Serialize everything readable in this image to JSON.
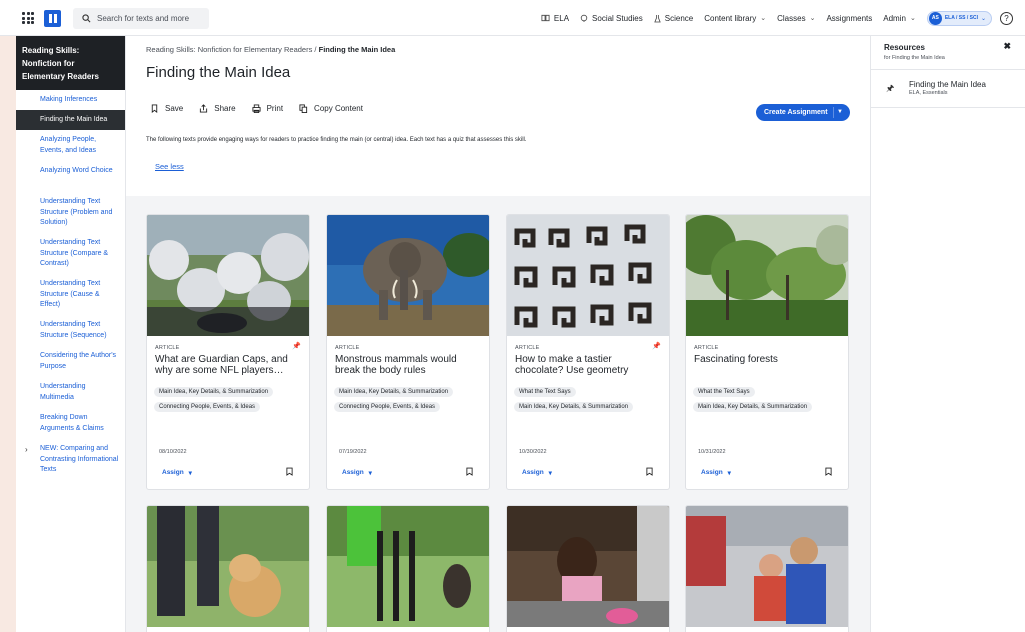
{
  "topbar": {
    "search_placeholder": "Search for texts and more",
    "nav": [
      {
        "label": "ELA",
        "icon": "book-icon"
      },
      {
        "label": "Social Studies",
        "icon": "globe-icon"
      },
      {
        "label": "Science",
        "icon": "flask-icon"
      },
      {
        "label": "Content library",
        "icon": "chevron-down-icon"
      },
      {
        "label": "Classes",
        "icon": "chevron-down-icon"
      },
      {
        "label": "Assignments"
      },
      {
        "label": "Admin",
        "icon": "chevron-down-icon"
      }
    ],
    "user_initials": "AS",
    "user_context": "ELA / SS / SCI"
  },
  "sidebar": {
    "heading": "Reading Skills: Nonfiction for Elementary Readers",
    "items": [
      "Making Inferences",
      "Finding the Main Idea",
      "Analyzing People, Events, and Ideas",
      "Analyzing Word Choice",
      "Understanding Text Structure (Problem and Solution)",
      "Understanding Text Structure (Compare & Contrast)",
      "Understanding Text Structure (Cause & Effect)",
      "Understanding Text Structure (Sequence)",
      "Considering the Author's Purpose",
      "Understanding Multimedia",
      "Breaking Down Arguments & Claims",
      "NEW: Comparing and Contrasting Informational Texts"
    ],
    "active_index": 1
  },
  "main": {
    "breadcrumb_parent": "Reading Skills: Nonfiction for Elementary Readers",
    "breadcrumb_sep": "/",
    "breadcrumb_current": "Finding the Main Idea",
    "title": "Finding the Main Idea",
    "actions": [
      "Save",
      "Share",
      "Print",
      "Copy Content"
    ],
    "create_button": "Create Assignment",
    "description": "The following texts provide engaging ways for readers to practice finding the main (or central) idea. Each text has a quiz that assesses this skill.",
    "see_less": "See less"
  },
  "cards": [
    {
      "type": "ARTICLE",
      "title": "What are Guardian Caps, and why are some NFL players…",
      "tags": [
        "Main Idea, Key Details, & Summarization",
        "Connecting People, Events, & Ideas"
      ],
      "date": "08/10/2022",
      "assign": "Assign",
      "pinned": true
    },
    {
      "type": "ARTICLE",
      "title": "Monstrous mammals would break the body rules",
      "tags": [
        "Main Idea, Key Details, & Summarization",
        "Connecting People, Events, & Ideas"
      ],
      "date": "07/19/2022",
      "assign": "Assign",
      "pinned": false
    },
    {
      "type": "ARTICLE",
      "title": "How to make a tastier chocolate? Use geometry",
      "tags": [
        "What the Text Says",
        "Main Idea, Key Details, & Summarization"
      ],
      "date": "10/30/2022",
      "assign": "Assign",
      "pinned": true
    },
    {
      "type": "ARTICLE",
      "title": "Fascinating forests",
      "tags": [
        "What the Text Says",
        "Main Idea, Key Details, & Summarization"
      ],
      "date": "10/31/2022",
      "assign": "Assign",
      "pinned": false
    }
  ],
  "resources": {
    "title": "Resources",
    "subtitle": "for Finding the Main Idea",
    "item_title": "Finding the Main Idea",
    "item_subtitle": "ELA, Essentials"
  },
  "colors": {
    "accent": "#1b5fd6",
    "sidebar_dark": "#1e2125"
  }
}
